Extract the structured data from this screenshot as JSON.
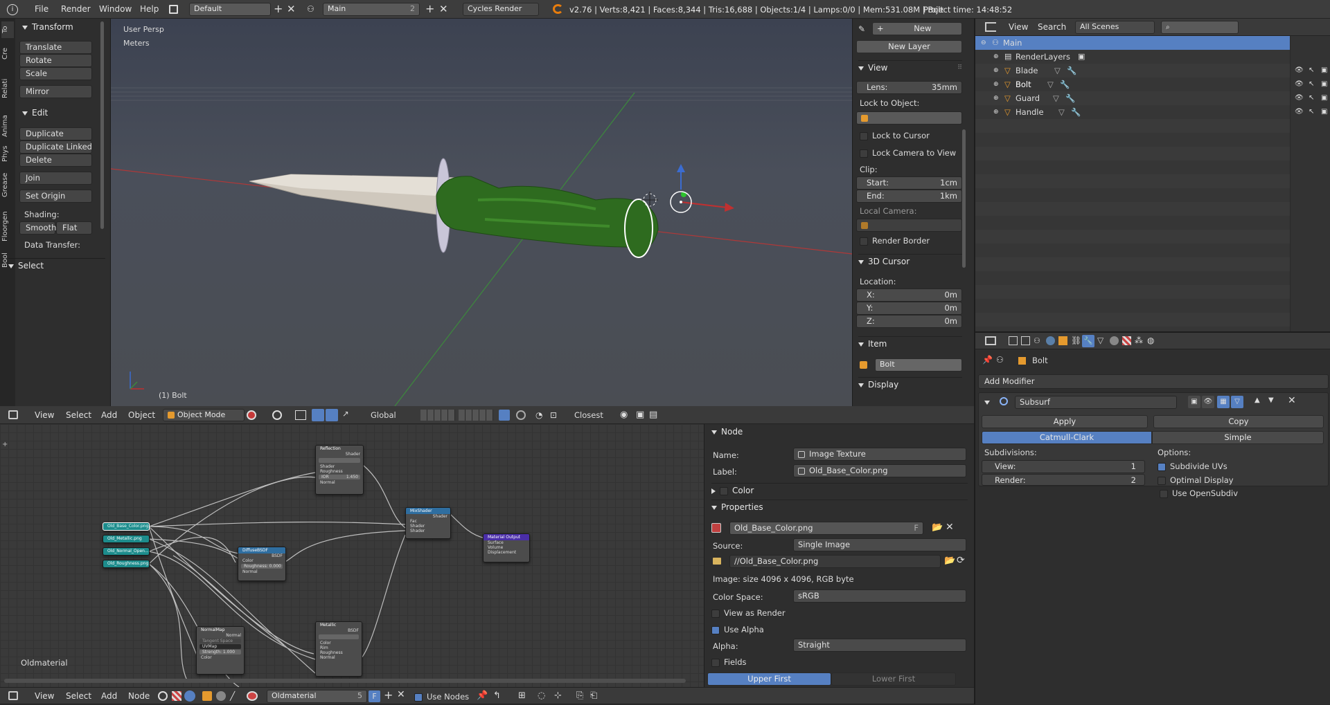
{
  "top_bar": {
    "menus": [
      "File",
      "Render",
      "Window",
      "Help"
    ],
    "screen_layout": "Default",
    "scene": "Main",
    "scene_users": "2",
    "render_engine": "Cycles Render",
    "stats": "v2.76 | Verts:8,421 | Faces:8,344 | Tris:16,688 | Objects:1/4 | Lamps:0/0 | Mem:531.08M | Bolt",
    "project_time": "Project time: 14:48:52"
  },
  "tool_shelf": {
    "tabs": [
      "To",
      "Cre",
      "Relati",
      "Anima",
      "Phys",
      "Grease",
      "Floorgen",
      "Bool"
    ],
    "transform_title": "Transform",
    "transform_buttons": [
      "Translate",
      "Rotate",
      "Scale",
      "Mirror"
    ],
    "edit_title": "Edit",
    "edit_buttons": [
      "Duplicate",
      "Duplicate Linked",
      "Delete",
      "Join",
      "Set Origin"
    ],
    "shading_label": "Shading:",
    "smooth": "Smooth",
    "flat": "Flat",
    "data_transfer": "Data Transfer:",
    "select_title": "Select"
  },
  "viewport": {
    "view_label": "User Persp",
    "units": "Meters",
    "object_label": "(1) Bolt"
  },
  "viewport_header": {
    "view": "View",
    "select": "Select",
    "add": "Add",
    "object": "Object",
    "mode": "Object Mode",
    "orientation": "Global",
    "snap": "Closest"
  },
  "n_panel": {
    "new_button": "New",
    "new_layer": "New Layer",
    "view_title": "View",
    "lens_label": "Lens:",
    "lens_value": "35mm",
    "lock_to_object": "Lock to Object:",
    "lock_to_cursor": "Lock to Cursor",
    "lock_camera": "Lock Camera to View",
    "clip_label": "Clip:",
    "start_label": "Start:",
    "start_value": "1cm",
    "end_label": "End:",
    "end_value": "1km",
    "local_camera": "Local Camera:",
    "render_border": "Render Border",
    "cursor_title": "3D Cursor",
    "location_label": "Location:",
    "x_label": "X:",
    "x_value": "0m",
    "y_label": "Y:",
    "y_value": "0m",
    "z_label": "Z:",
    "z_value": "0m",
    "item_title": "Item",
    "item_name": "Bolt",
    "display_title": "Display"
  },
  "outliner": {
    "view": "View",
    "search": "Search",
    "scenes": "All Scenes",
    "items": [
      {
        "name": "Main",
        "level": 0,
        "selected": true
      },
      {
        "name": "RenderLayers",
        "level": 1
      },
      {
        "name": "Blade",
        "level": 1
      },
      {
        "name": "Bolt",
        "level": 1
      },
      {
        "name": "Guard",
        "level": 1
      },
      {
        "name": "Handle",
        "level": 1
      }
    ]
  },
  "properties": {
    "object_name": "Bolt",
    "add_modifier": "Add Modifier",
    "modifier_name": "Subsurf",
    "apply": "Apply",
    "copy": "Copy",
    "catmull": "Catmull-Clark",
    "simple": "Simple",
    "subdivisions": "Subdivisions:",
    "view_label": "View:",
    "view_value": "1",
    "render_label": "Render:",
    "render_value": "2",
    "options": "Options:",
    "subdivide_uvs": "Subdivide UVs",
    "optimal_display": "Optimal Display",
    "use_opensubdiv": "Use OpenSubdiv"
  },
  "node_editor": {
    "material_label": "Oldmaterial",
    "nodes": {
      "reflection": "Reflection",
      "shader": "Shader",
      "roughness": "Roughness",
      "normal": "Normal",
      "ior": "IOR",
      "ior_value": "1.450",
      "mixshader": "MixShader",
      "fac": "Fac",
      "output": "Material Output",
      "surface": "Surface",
      "volume": "Volume",
      "displacement": "Displacement",
      "diffuse": "DiffuseBSDF",
      "bsdf": "BSDF",
      "color": "Color",
      "rough_val": "Roughness: 0.000",
      "normalmap": "NormalMap",
      "tangent": "Tangent Space",
      "uvmap": "UVMap",
      "strength": "Strength: 1.000",
      "metallic": "Metallic",
      "rim": "Rim",
      "img1": "Old_Base_Color.png",
      "img2": "Old_Metallic.png",
      "img3": "Old_Normal_Open...",
      "img4": "Old_Roughness.png"
    }
  },
  "node_panel": {
    "node_title": "Node",
    "name_label": "Name:",
    "name_value": "Image Texture",
    "label_label": "Label:",
    "label_value": "Old_Base_Color.png",
    "color_title": "Color",
    "properties_title": "Properties",
    "image_name": "Old_Base_Color.png",
    "image_flag": "F",
    "source_label": "Source:",
    "source_value": "Single Image",
    "filepath": "//Old_Base_Color.png",
    "image_info": "Image: size 4096 x 4096, RGB byte",
    "colorspace_label": "Color Space:",
    "colorspace_value": "sRGB",
    "view_as_render": "View as Render",
    "use_alpha": "Use Alpha",
    "alpha_label": "Alpha:",
    "alpha_value": "Straight",
    "fields": "Fields",
    "upper_first": "Upper First",
    "lower_first": "Lower First"
  },
  "node_header": {
    "view": "View",
    "select": "Select",
    "add": "Add",
    "node": "Node",
    "material": "Oldmaterial",
    "users": "5",
    "flag": "F",
    "use_nodes": "Use Nodes"
  },
  "colors": {
    "accent": "#5680c2",
    "handle": "#2e6b1f",
    "blade": "#d8d3c8",
    "teal_node": "#1d8c8c"
  }
}
